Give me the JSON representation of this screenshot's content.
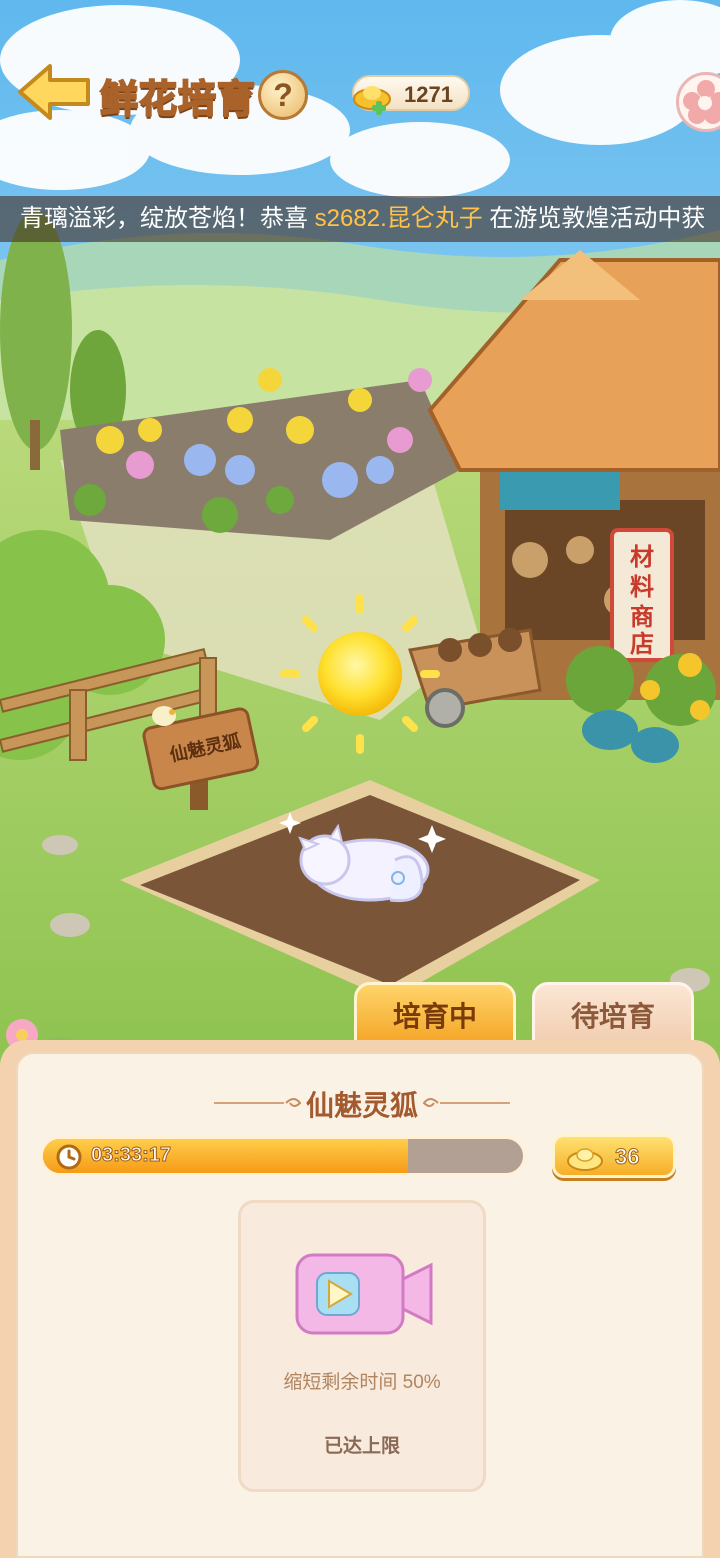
{
  "header": {
    "title": "鲜花培育",
    "help_label": "?",
    "currency_value": "1271"
  },
  "marquee": {
    "part1": "青璃溢彩，绽放苍焰！恭喜 ",
    "highlight": "s2682.昆仑丸子",
    "part2": " 在游览敦煌活动中获"
  },
  "scene": {
    "sign_text": "仙魅灵狐",
    "shop_sign": "材料商店"
  },
  "tabs": [
    {
      "label": "培育中",
      "active": true
    },
    {
      "label": "待培育",
      "active": false
    }
  ],
  "panel": {
    "title": "仙魅灵狐",
    "timer": "03:33:17",
    "progress_fraction": 0.76,
    "cost_value": "36",
    "boost_desc": "缩短剩余时间 50%",
    "boost_status": "已达上限"
  },
  "colors": {
    "accent_orange": "#f59b18",
    "panel_bg": "#fbf2e6",
    "title_brown": "#a35a2e"
  }
}
